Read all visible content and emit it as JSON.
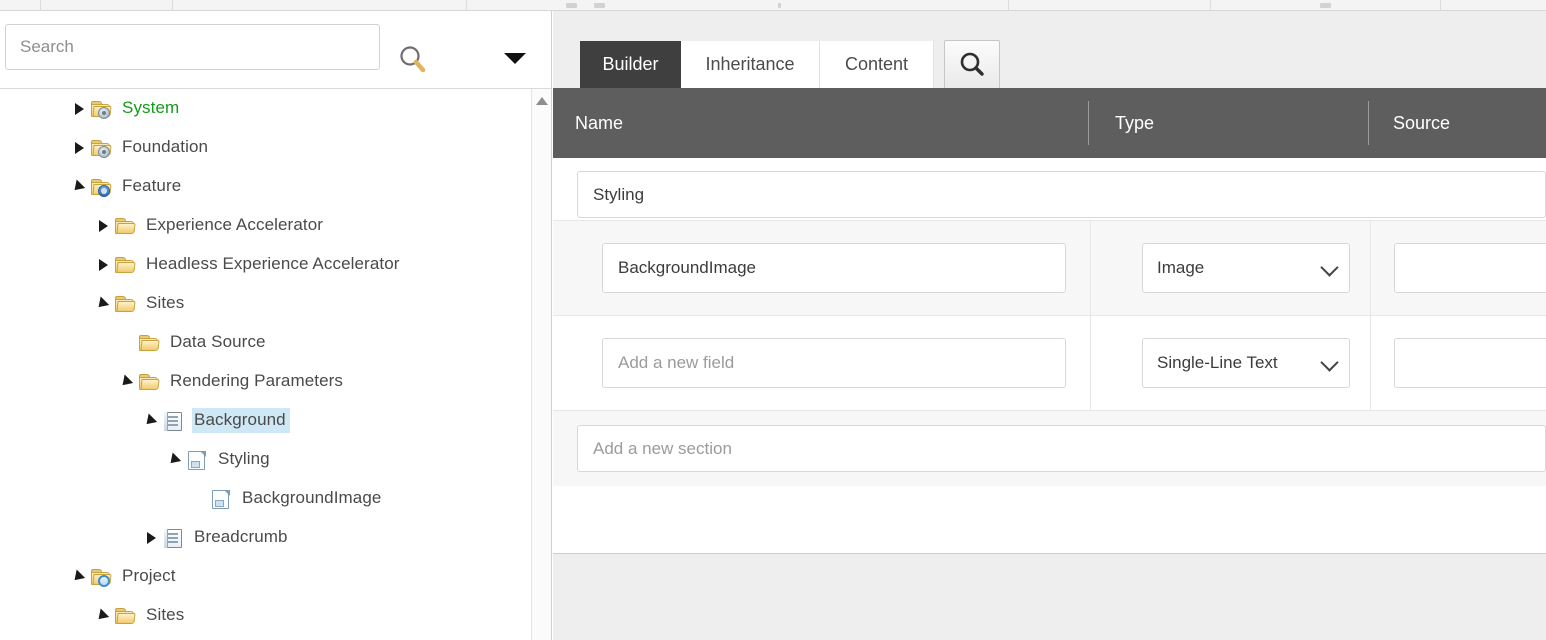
{
  "app": {
    "name": "sitecore-template-builder"
  },
  "left_panel": {
    "search": {
      "placeholder": "Search",
      "value": "",
      "go_icon": "search-icon",
      "caret_icon": "chevron-down-icon"
    },
    "scrollbar": {
      "up_icon": "scroll-up-arrow-icon"
    },
    "tree": [
      {
        "label": "System",
        "icon": "folder-gear-icon",
        "state": "collapsed",
        "depth": 0,
        "selected": false,
        "color": "green"
      },
      {
        "label": "Foundation",
        "icon": "folder-gear-icon",
        "state": "collapsed",
        "depth": 0,
        "selected": false,
        "color": "normal"
      },
      {
        "label": "Feature",
        "icon": "folder-puzzle-icon",
        "state": "expanded",
        "depth": 0,
        "selected": false,
        "color": "normal"
      },
      {
        "label": "Experience Accelerator",
        "icon": "folder-icon",
        "state": "collapsed",
        "depth": 1,
        "selected": false,
        "color": "normal"
      },
      {
        "label": "Headless Experience Accelerator",
        "icon": "folder-icon",
        "state": "collapsed",
        "depth": 1,
        "selected": false,
        "color": "normal"
      },
      {
        "label": "Sites",
        "icon": "folder-icon",
        "state": "expanded",
        "depth": 1,
        "selected": false,
        "color": "normal"
      },
      {
        "label": "Data Source",
        "icon": "folder-icon",
        "state": "leaf",
        "depth": 2,
        "selected": false,
        "color": "normal"
      },
      {
        "label": "Rendering Parameters",
        "icon": "folder-icon",
        "state": "expanded",
        "depth": 2,
        "selected": false,
        "color": "normal"
      },
      {
        "label": "Background",
        "icon": "template-icon",
        "state": "expanded",
        "depth": 3,
        "selected": true,
        "color": "normal"
      },
      {
        "label": "Styling",
        "icon": "document-icon",
        "state": "expanded",
        "depth": 4,
        "selected": false,
        "color": "normal"
      },
      {
        "label": "BackgroundImage",
        "icon": "document-icon",
        "state": "leaf",
        "depth": 5,
        "selected": false,
        "color": "normal"
      },
      {
        "label": "Breadcrumb",
        "icon": "template-icon",
        "state": "collapsed",
        "depth": 3,
        "selected": false,
        "color": "normal"
      },
      {
        "label": "Project",
        "icon": "folder-square-icon",
        "state": "expanded",
        "depth": 0,
        "selected": false,
        "color": "normal"
      },
      {
        "label": "Sites",
        "icon": "folder-icon",
        "state": "expanded",
        "depth": 1,
        "selected": false,
        "color": "normal"
      }
    ]
  },
  "right_panel": {
    "tabs": [
      {
        "label": "Builder",
        "active": true
      },
      {
        "label": "Inheritance",
        "active": false
      },
      {
        "label": "Content",
        "active": false
      }
    ],
    "search_button_icon": "search-icon",
    "columns": [
      {
        "label": "Name"
      },
      {
        "label": "Type"
      },
      {
        "label": "Source"
      }
    ],
    "rows": [
      {
        "kind": "section",
        "name_value": "Styling",
        "name_placeholder": ""
      },
      {
        "kind": "field",
        "name_value": "BackgroundImage",
        "name_placeholder": "",
        "type_value": "Image",
        "source_value": "",
        "type_icon": "chevron-down-icon"
      },
      {
        "kind": "new-field",
        "name_value": "",
        "name_placeholder": "Add a new field",
        "type_value": "Single-Line Text",
        "source_value": "",
        "type_icon": "chevron-down-icon"
      },
      {
        "kind": "new-section",
        "name_value": "",
        "name_placeholder": "Add a new section"
      }
    ]
  },
  "colors": {
    "header_bar": "#5e5e5e",
    "active_tab": "#3f3f3f",
    "selection": "#cfe8f5",
    "system_green": "#159a19",
    "panel_bg": "#eeeeee"
  }
}
